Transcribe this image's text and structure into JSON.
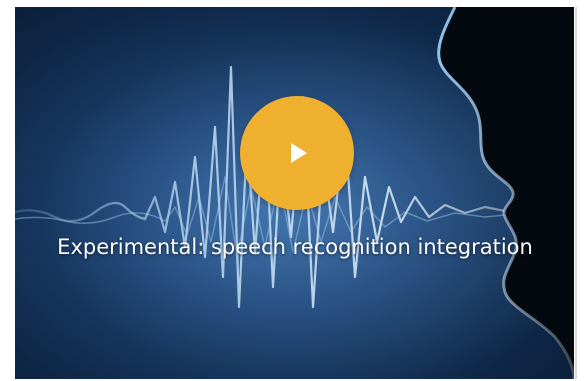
{
  "video": {
    "title": "Experimental: speech recognition integration",
    "play_icon": "play-icon",
    "colors": {
      "play_button": "#efb02f",
      "background_center": "#2f5f96",
      "background_edge": "#0a1b34",
      "title_text": "#ffffff"
    }
  }
}
